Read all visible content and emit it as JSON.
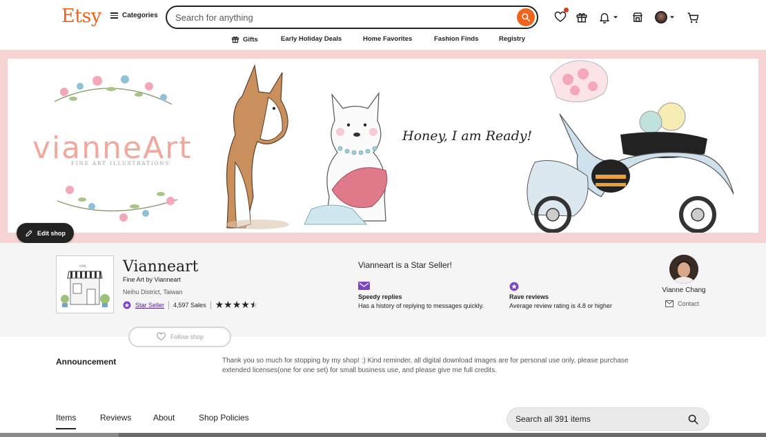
{
  "header": {
    "logo": "Etsy",
    "categories_label": "Categories",
    "search_placeholder": "Search for anything"
  },
  "nav": {
    "items": [
      {
        "label": "Gifts",
        "icon": "gift-icon"
      },
      {
        "label": "Early Holiday Deals"
      },
      {
        "label": "Home Favorites"
      },
      {
        "label": "Fashion Finds"
      },
      {
        "label": "Registry"
      }
    ]
  },
  "banner": {
    "brand": "vianneArt",
    "tagline": "FINE ART ILLUSTRATIONS",
    "script": "Honey, I am Ready!"
  },
  "edit_shop_label": "Edit shop",
  "shop": {
    "name": "Vianneart",
    "title": "Fine Art by Vianneart",
    "location": "Neihu District, Taiwan",
    "star_seller": "Star Seller",
    "sales": "4,597 Sales",
    "rating": 4.5
  },
  "star_seller_box": {
    "heading": "Vianneart is a Star Seller!",
    "features": [
      {
        "title": "Speedy replies",
        "desc": "Has a history of replying to messages quickly."
      },
      {
        "title": "Rave reviews",
        "desc": "Average review rating is 4.8 or higher"
      }
    ]
  },
  "owner": {
    "name": "Vianne Chang",
    "contact_label": "Contact"
  },
  "follow_label": "Follow shop",
  "announcement": {
    "label": "Announcement",
    "text": "Thank you so much for stopping by my shop! :) Kind reminder, all digital download images are for personal use only, please purchase extended licenses(one for one set) for small business use, and please give me full credits."
  },
  "tabs": [
    {
      "label": "Items"
    },
    {
      "label": "Reviews"
    },
    {
      "label": "About"
    },
    {
      "label": "Shop Policies"
    }
  ],
  "item_search_placeholder": "Search all 391 items",
  "colors": {
    "brand": "#F1641E",
    "star_seller": "#7B43C7",
    "banner_border": "#F7D3D3"
  }
}
